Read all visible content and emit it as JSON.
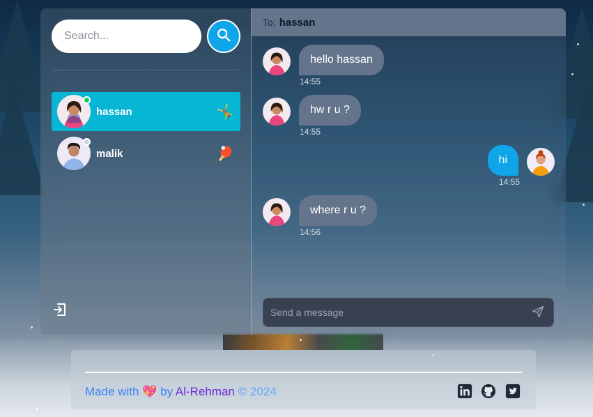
{
  "search": {
    "placeholder": "Search..."
  },
  "conversations": [
    {
      "name": "hassan",
      "emoji": "🤸",
      "online": true,
      "active": true
    },
    {
      "name": "malik",
      "emoji": "🏓",
      "online": false,
      "active": false
    }
  ],
  "chat": {
    "to_label": "To:",
    "to_name": "hassan",
    "messages": [
      {
        "from": "them",
        "text": "hello hassan",
        "time": "14:55"
      },
      {
        "from": "them",
        "text": "hw r u ?",
        "time": "14:55"
      },
      {
        "from": "me",
        "text": "hi",
        "time": "14:55"
      },
      {
        "from": "them",
        "text": "where r u ?",
        "time": "14:56"
      }
    ],
    "composer_placeholder": "Send a message"
  },
  "footer": {
    "made_with": "Made with",
    "heart": "💖",
    "by": "by",
    "author": "Al-Rehman",
    "copyright": "© 2024"
  },
  "colors": {
    "accent": "#0ea5e9",
    "active_conversation": "#06b6d4",
    "online": "#22c55e",
    "offline": "#cbd5e1",
    "bubble_them": "#64748b"
  },
  "icons": {
    "search": "search-icon",
    "logout": "logout-icon",
    "send": "send-icon",
    "linkedin": "linkedin-icon",
    "github": "github-icon",
    "twitter": "twitter-icon"
  }
}
